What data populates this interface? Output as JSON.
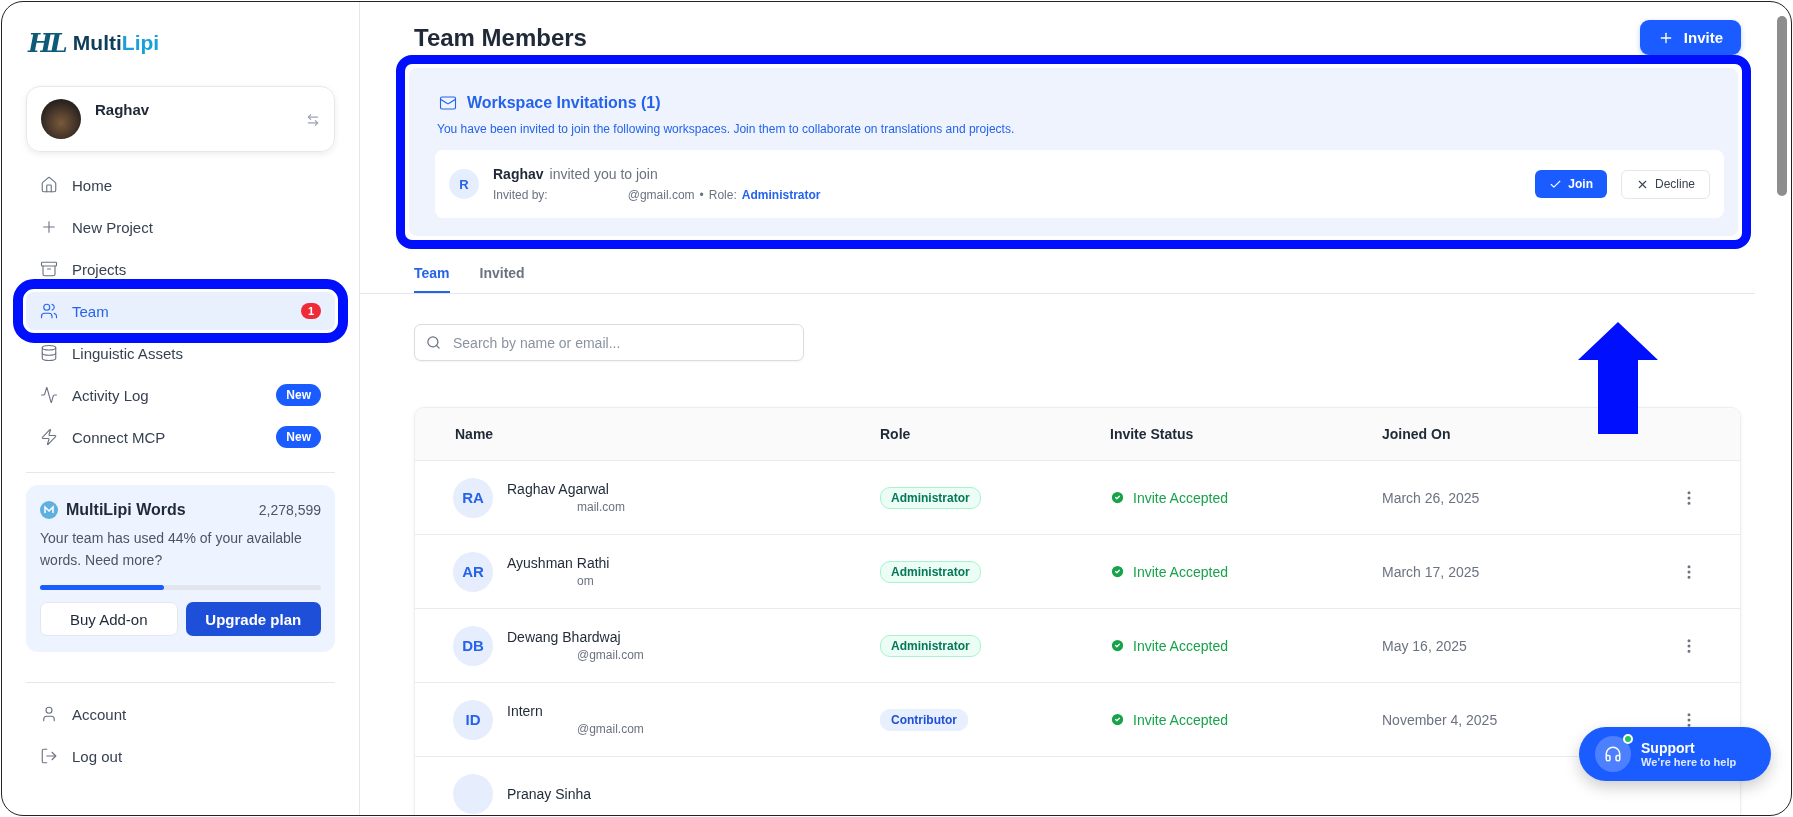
{
  "sidebar": {
    "logo": {
      "mark": "HL",
      "brand_part_1": "Multi",
      "brand_part_2": "Lipi"
    },
    "profile": {
      "name": "Raghav"
    },
    "nav": [
      {
        "kind": "home",
        "label": "Home",
        "selected": false,
        "highlighted": false
      },
      {
        "kind": "plus",
        "label": "New Project",
        "selected": false,
        "highlighted": false
      },
      {
        "kind": "archive",
        "label": "Projects",
        "selected": false,
        "highlighted": false
      },
      {
        "kind": "team",
        "label": "Team",
        "selected": true,
        "highlighted": true,
        "count": "1"
      },
      {
        "kind": "database",
        "label": "Linguistic Assets",
        "selected": false,
        "highlighted": false
      },
      {
        "kind": "activity",
        "label": "Activity Log",
        "selected": false,
        "highlighted": false,
        "badge": "New"
      },
      {
        "kind": "bolt",
        "label": "Connect MCP",
        "selected": false,
        "highlighted": false,
        "badge": "New"
      }
    ],
    "words": {
      "title": "MultiLipi Words",
      "count": "2,278,599",
      "text": "Your team has used 44% of your available words. Need more?",
      "level": 0.44,
      "buttons": [
        "Buy Add-on",
        "Upgrade plan"
      ]
    },
    "bottom_nav": [
      {
        "kind": "user",
        "label": "Account"
      },
      {
        "kind": "logout",
        "label": "Log out"
      }
    ]
  },
  "header": {
    "title": "Team Members",
    "invite_button": "Invite"
  },
  "invitations": {
    "highlighted": true,
    "title": "Workspace Invitations (1)",
    "description": "You have been invited to join the following workspaces. Join them to collaborate on translations and projects.",
    "items": [
      {
        "initial": "R",
        "inviter": "Raghav",
        "action": "invited you to join",
        "invited_by_label": "Invited by:",
        "email": "@gmail.com",
        "separator": "•",
        "role_label": "Role:",
        "role": "Administrator",
        "join": "Join",
        "decline": "Decline"
      }
    ]
  },
  "arrow": true,
  "tabs": [
    {
      "label": "Team",
      "selected": true
    },
    {
      "label": "Invited",
      "selected": false
    }
  ],
  "search": {
    "placeholder": "Search by name or email..."
  },
  "table": {
    "columns": [
      "Name",
      "Role",
      "Invite Status",
      "Joined On"
    ],
    "rows": [
      {
        "initials": "RA",
        "name": "Raghav Agarwal",
        "email": "mail.com",
        "role": "Administrator",
        "kind": "admin",
        "status": "Invite Accepted",
        "joined": "March 26, 2025"
      },
      {
        "initials": "AR",
        "name": "Ayushman Rathi",
        "email": "om",
        "role": "Administrator",
        "kind": "admin",
        "status": "Invite Accepted",
        "joined": "March 17, 2025"
      },
      {
        "initials": "DB",
        "name": "Dewang Bhardwaj",
        "email": "@gmail.com",
        "role": "Administrator",
        "kind": "admin",
        "status": "Invite Accepted",
        "joined": "May 16, 2025"
      },
      {
        "initials": "ID",
        "name": "Intern",
        "email": "@gmail.com",
        "role": "Contributor",
        "kind": "contributor",
        "status": "Invite Accepted",
        "joined": "November 4, 2025"
      },
      {
        "name": "Pranay Sinha"
      }
    ]
  },
  "support": {
    "title": "Support",
    "subtitle": "We’re here to help",
    "online": true
  }
}
